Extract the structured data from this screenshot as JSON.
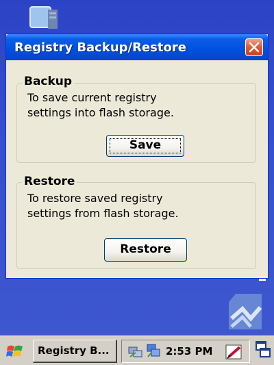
{
  "dialog": {
    "title": "Registry Backup/Restore",
    "close_icon": "close-icon",
    "backup": {
      "label": "Backup",
      "description": [
        "To save current registry",
        "settings into flash storage."
      ],
      "button_label": "Save"
    },
    "restore": {
      "label": "Restore",
      "description": [
        "To restore saved registry",
        "settings from flash storage."
      ],
      "button_label": "Restore"
    }
  },
  "taskbar": {
    "start_icon": "windows-flag-icon",
    "task_button_label": "Registry B...",
    "clock": "2:53 PM",
    "tray_icons": [
      "network-icon",
      "connection-icon",
      "input-panel-icon",
      "windows-switch-icon"
    ]
  },
  "colors": {
    "desktop": "#3550d0",
    "titlebar": "#0050e0",
    "dialog_face": "#ece9d8",
    "close_button": "#e0603c"
  }
}
